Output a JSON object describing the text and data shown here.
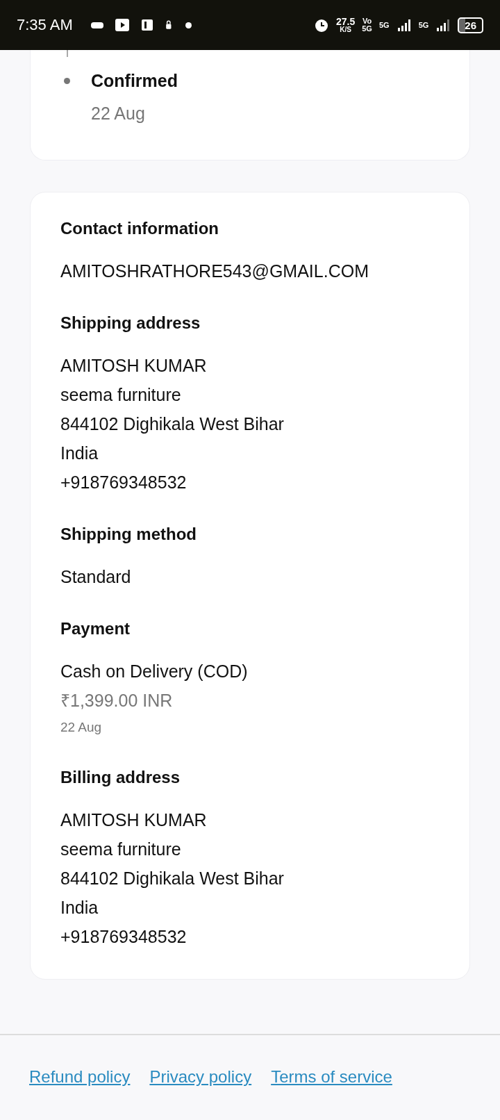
{
  "status_bar": {
    "time": "7:35 AM",
    "speed_value": "27.5",
    "speed_unit": "K/S",
    "volte_top": "Vo",
    "volte_bottom": "5G",
    "sim1": "5G",
    "sim2": "5G",
    "battery": "26"
  },
  "timeline": [
    {
      "label": "Confirmed",
      "date": "22 Aug"
    }
  ],
  "details": [
    {
      "title": "Contact information",
      "lines": [
        {
          "text": "AMITOSHRATHORE543@GMAIL.COM",
          "kind": "body"
        }
      ]
    },
    {
      "title": "Shipping address",
      "lines": [
        {
          "text": "AMITOSH KUMAR",
          "kind": "body"
        },
        {
          "text": "seema furniture",
          "kind": "body"
        },
        {
          "text": "844102 Dighikala West Bihar",
          "kind": "body"
        },
        {
          "text": "India",
          "kind": "body"
        },
        {
          "text": "+918769348532",
          "kind": "body"
        }
      ]
    },
    {
      "title": "Shipping method",
      "lines": [
        {
          "text": "Standard",
          "kind": "body"
        }
      ]
    },
    {
      "title": "Payment",
      "lines": [
        {
          "text": "Cash on Delivery (COD)",
          "kind": "body"
        },
        {
          "text": "₹1,399.00 INR",
          "kind": "muted"
        },
        {
          "text": "22 Aug",
          "kind": "small"
        }
      ]
    },
    {
      "title": "Billing address",
      "lines": [
        {
          "text": "AMITOSH KUMAR",
          "kind": "body"
        },
        {
          "text": "seema furniture",
          "kind": "body"
        },
        {
          "text": "844102 Dighikala West Bihar",
          "kind": "body"
        },
        {
          "text": "India",
          "kind": "body"
        },
        {
          "text": "+918769348532",
          "kind": "body"
        }
      ]
    }
  ],
  "footer_links": [
    "Refund policy",
    "Privacy policy",
    "Terms of service"
  ]
}
